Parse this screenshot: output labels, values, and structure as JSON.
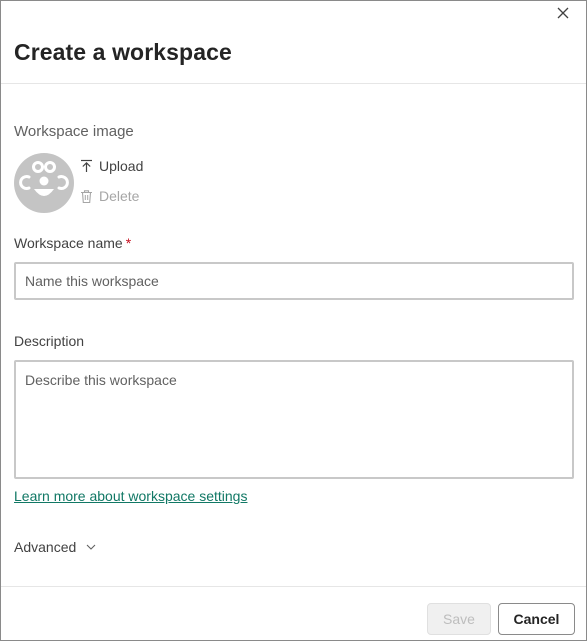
{
  "dialog": {
    "title": "Create a workspace",
    "close_icon": "close-icon"
  },
  "image_section": {
    "label": "Workspace image",
    "avatar_icon": "workspace-face-icon",
    "upload": {
      "label": "Upload",
      "icon": "upload-arrow-icon"
    },
    "delete": {
      "label": "Delete",
      "icon": "trash-icon",
      "disabled": true
    }
  },
  "name_field": {
    "label": "Workspace name",
    "required_mark": "*",
    "value": "",
    "placeholder": "Name this workspace"
  },
  "description_field": {
    "label": "Description",
    "value": "",
    "placeholder": "Describe this workspace"
  },
  "learn_more_link": "Learn more about workspace settings",
  "advanced": {
    "label": "Advanced",
    "icon": "chevron-down-icon",
    "expanded": false
  },
  "footer": {
    "save_label": "Save",
    "save_disabled": true,
    "cancel_label": "Cancel"
  },
  "colors": {
    "link": "#117865",
    "required": "#c50f1f",
    "avatar_bg": "#c4c4c4",
    "input_border": "#c8c8c8"
  }
}
